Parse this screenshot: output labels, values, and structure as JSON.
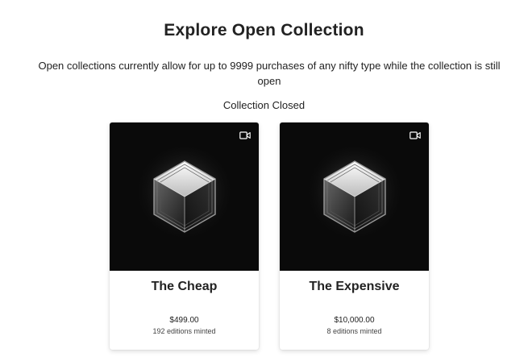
{
  "page": {
    "title": "Explore Open Collection",
    "description": "Open collections currently allow for up to 9999 purchases of any nifty type while the collection is still open",
    "status": "Collection Closed"
  },
  "cards": [
    {
      "name": "The Cheap",
      "price": "$499.00",
      "editions": "192 editions minted",
      "media_icon": "video-camera-icon"
    },
    {
      "name": "The Expensive",
      "price": "$10,000.00",
      "editions": "8 editions minted",
      "media_icon": "video-camera-icon"
    }
  ],
  "colors": {
    "media_background": "#0a0a0a",
    "text": "#222222"
  }
}
